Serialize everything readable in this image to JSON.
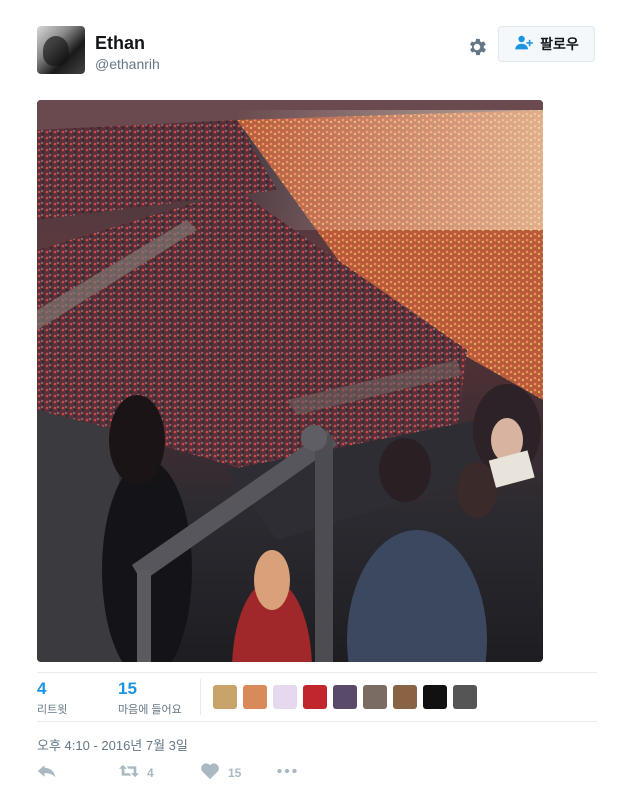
{
  "user": {
    "name": "Ethan",
    "handle": "@ethanrih",
    "follow_label": "팔로우"
  },
  "stats": {
    "retweets": "4",
    "retweets_label": "리트윗",
    "likes": "15",
    "likes_label": "마음에 들어요"
  },
  "likers": [
    {
      "color": "#c9a46a"
    },
    {
      "color": "#d88a5a"
    },
    {
      "color": "#e6d9ef"
    },
    {
      "color": "#c0262b"
    },
    {
      "color": "#5a4a6a"
    },
    {
      "color": "#7a6b63"
    },
    {
      "color": "#8a6244"
    },
    {
      "color": "#111111"
    },
    {
      "color": "#555555"
    }
  ],
  "timestamp": "오후 4:10 - 2016년 7월 3일",
  "actions": {
    "retweet_count": "4",
    "like_count": "15"
  },
  "colors": {
    "link_blue": "#1b95e0",
    "muted": "#657786",
    "icon_gray": "#aab8c2"
  }
}
